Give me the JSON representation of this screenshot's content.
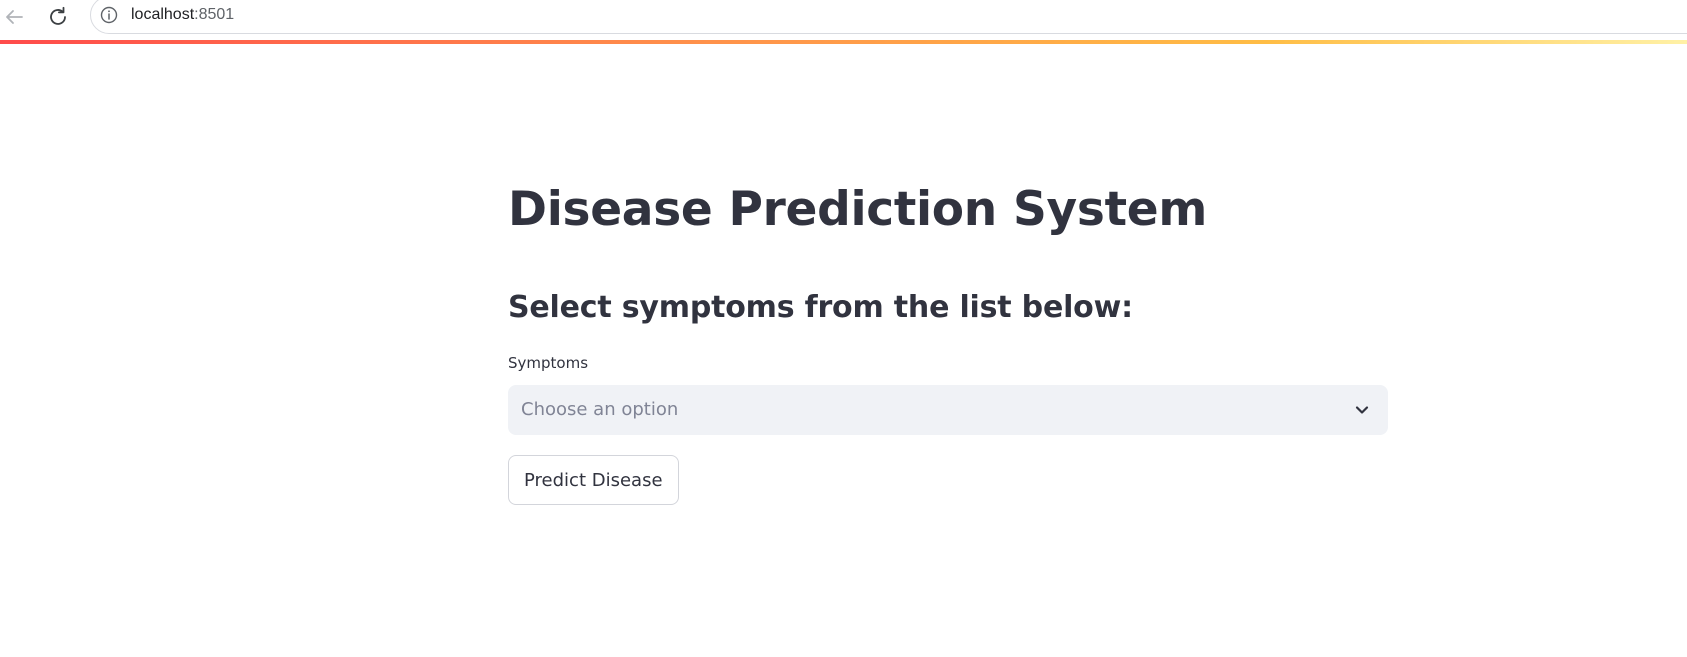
{
  "browser": {
    "url_host": "localhost",
    "url_port": ":8501",
    "back_icon": "arrow-left-icon",
    "reload_icon": "reload-icon",
    "site_info_icon": "info-icon"
  },
  "theme": {
    "primary_text": "#31333f",
    "input_bg": "#f0f2f6",
    "placeholder_text": "#808495",
    "decoration_gradient": [
      "#ff4b4b",
      "#ffbd45",
      "#fff1a6"
    ]
  },
  "main": {
    "title": "Disease Prediction System",
    "subheader": "Select symptoms from the list below:",
    "symptoms_select": {
      "label": "Symptoms",
      "placeholder": "Choose an option",
      "icon": "chevron-down-icon"
    },
    "predict_button_label": "Predict Disease"
  }
}
